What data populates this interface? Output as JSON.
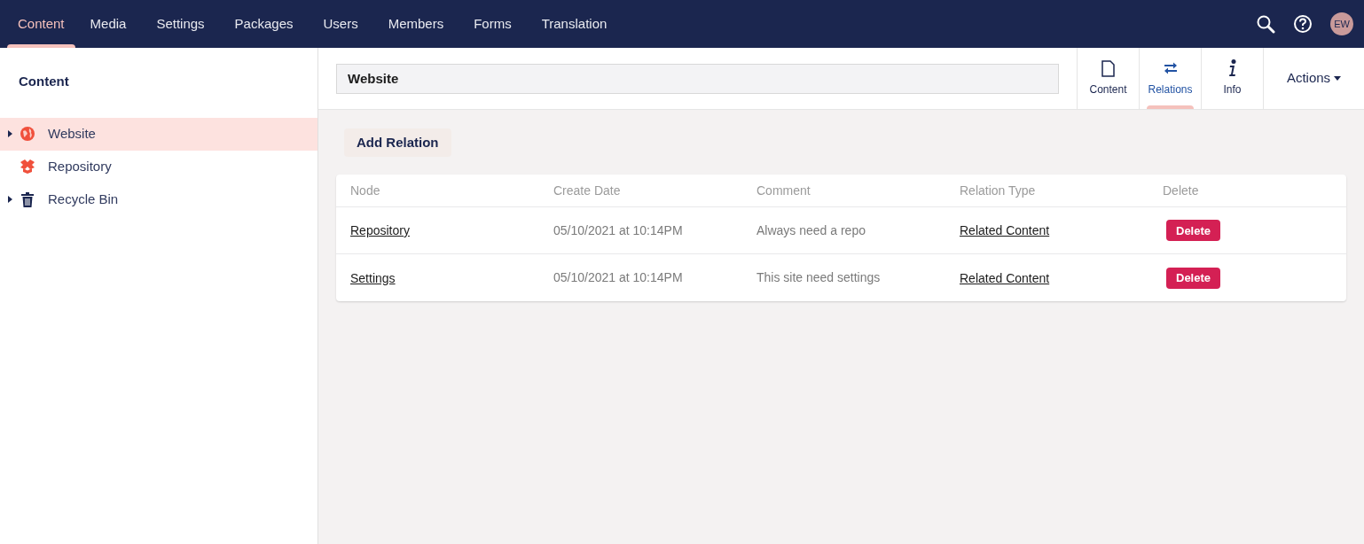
{
  "top_nav": {
    "sections": [
      {
        "label": "Content",
        "selected": true
      },
      {
        "label": "Media",
        "selected": false
      },
      {
        "label": "Settings",
        "selected": false
      },
      {
        "label": "Packages",
        "selected": false
      },
      {
        "label": "Users",
        "selected": false
      },
      {
        "label": "Members",
        "selected": false
      },
      {
        "label": "Forms",
        "selected": false
      },
      {
        "label": "Translation",
        "selected": false
      }
    ],
    "avatar": "EW"
  },
  "sidebar": {
    "title": "Content",
    "tree": [
      {
        "label": "Website",
        "kind": "globe",
        "selected": true,
        "has_children": true
      },
      {
        "label": "Repository",
        "kind": "box",
        "selected": false,
        "has_children": false
      },
      {
        "label": "Recycle Bin",
        "kind": "trash",
        "selected": false,
        "has_children": true
      }
    ]
  },
  "editor": {
    "name_field": "Website",
    "apps": [
      {
        "label": "Content",
        "kind": "document",
        "selected": false
      },
      {
        "label": "Relations",
        "kind": "arrows",
        "selected": true
      },
      {
        "label": "Info",
        "kind": "info",
        "selected": false
      }
    ],
    "actions": "Actions",
    "add_button": "Add Relation",
    "table": {
      "columns": [
        "Node",
        "Create Date",
        "Comment",
        "Relation Type",
        "Delete"
      ],
      "rows": [
        {
          "node": "Repository",
          "date": "05/10/2021 at 10:14PM",
          "comment": "Always need a repo",
          "type": "Related Content",
          "action": "Delete"
        },
        {
          "node": "Settings",
          "date": "05/10/2021 at 10:14PM",
          "comment": "This site need settings",
          "type": "Related Content",
          "action": "Delete"
        }
      ]
    }
  }
}
